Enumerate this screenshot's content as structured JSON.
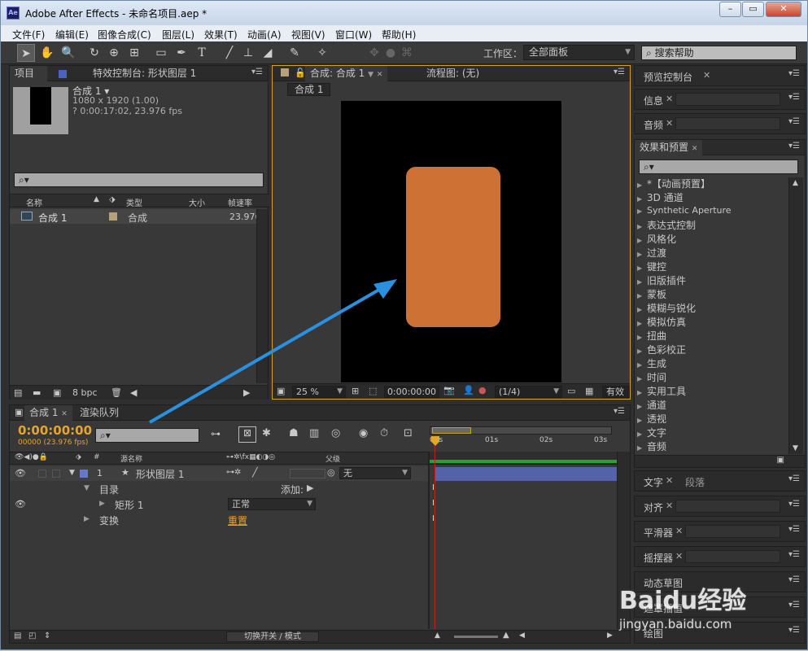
{
  "window": {
    "title": "Adobe After Effects - 未命名项目.aep *",
    "app_icon": "Ae",
    "min_label": "–",
    "restore_label": "▭",
    "close_label": "✕"
  },
  "menu": [
    "文件(F)",
    "编辑(E)",
    "图像合成(C)",
    "图层(L)",
    "效果(T)",
    "动画(A)",
    "视图(V)",
    "窗口(W)",
    "帮助(H)"
  ],
  "toolbar": {
    "workspace_label": "工作区：",
    "workspace_value": "全部面板",
    "help_search": "搜索帮助"
  },
  "project": {
    "tab_label": "项目",
    "effects_tab_label": "特效控制台: 形状图层 1",
    "comp_name": "合成 1 ▾",
    "comp_size": "1080 x 1920 (1.00)",
    "comp_duration": "? 0:00:17:02, 23.976 fps",
    "col_name": "名称",
    "col_type": "类型",
    "col_size": "大小",
    "col_fps": "帧速率",
    "row_name": "合成 1",
    "row_type": "合成",
    "row_fps": "23.976",
    "bpc": "8 bpc"
  },
  "viewer": {
    "comp_tab": "合成: 合成 1",
    "flow_tab": "流程图: (无)",
    "subtab": "合成 1",
    "zoom": "25 %",
    "timecode": "0:00:00:00",
    "resolution": "(1/4)",
    "active_cam": "有效"
  },
  "colors": {
    "shape_fill": "#cd7135",
    "arrow": "#2a90e0",
    "layer_bar": "#5462a8",
    "accent": "#e6a42a"
  },
  "right_panels": {
    "preview": "预览控制台",
    "info": "信息",
    "audio": "音频",
    "effects_presets": "效果和预置",
    "effects_list": [
      "*【动画预置】",
      "3D 通道",
      "Synthetic Aperture",
      "表达式控制",
      "风格化",
      "过渡",
      "键控",
      "旧版插件",
      "蒙板",
      "模糊与锐化",
      "模拟仿真",
      "扭曲",
      "色彩校正",
      "生成",
      "时间",
      "实用工具",
      "通道",
      "透视",
      "文字",
      "音频"
    ],
    "text_tab": "文字",
    "paragraph_tab": "段落",
    "align": "对齐",
    "smoother": "平滑器",
    "wiggler": "摇摆器",
    "motion_sketch": "动态草图",
    "mask_interp": "遮罩插值",
    "paint": "绘图"
  },
  "timeline": {
    "tab_label": "合成 1",
    "render_tab": "渲染队列",
    "timecode": "0:00:00:00",
    "frame_info": "00000 (23.976 fps)",
    "col_num": "#",
    "col_source": "源名称",
    "col_parent": "父级",
    "layer_num": "1",
    "layer_name": "形状图层 1",
    "parent_value": "无",
    "contents_label": "目录",
    "add_label": "添加:",
    "rect_label": "矩形 1",
    "blend_mode": "正常",
    "transform_label": "变换",
    "reset_label": "重置",
    "ruler": [
      "00s",
      "01s",
      "02s",
      "03s"
    ],
    "switch_mode": "切换开关 / 模式"
  },
  "watermark": {
    "brand": "Baidu经验",
    "url": "jingyan.baidu.com"
  }
}
